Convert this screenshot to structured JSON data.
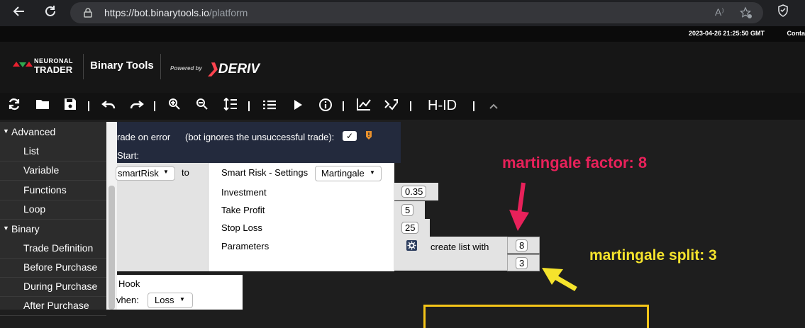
{
  "browser": {
    "url_host": "https://bot.binarytools.io",
    "url_path": "/platform",
    "read_aloud_label": "A⁾"
  },
  "topline": {
    "timestamp": "2023-04-26 21:25:50 GMT",
    "contact": "Conta"
  },
  "header": {
    "brand_top": "NEURONAL",
    "brand_bottom": "TRADER",
    "app_name": "Binary Tools",
    "powered_by": "Powered by",
    "deriv": "DERIV"
  },
  "toolbar": {
    "hid_label": "H-ID"
  },
  "sidebar": {
    "categories": [
      {
        "label": "Advanced",
        "items": [
          "List",
          "Variable",
          "Functions",
          "Loop"
        ]
      },
      {
        "label": "Binary",
        "items": [
          "Trade Definition",
          "Before Purchase",
          "During Purchase",
          "After Purchase"
        ]
      }
    ]
  },
  "workspace": {
    "trade_on_error": "rade on error",
    "bot_ignores": "(bot ignores the unsuccessful trade):",
    "checkbox_mark": "✓",
    "start_label": "Start:",
    "var_name": "smartRisk",
    "to_label": "to",
    "smart_risk_settings": "Smart Risk - Settings",
    "strategy": "Martingale",
    "params": [
      {
        "label": "Investment",
        "value": "0.35"
      },
      {
        "label": "Take Profit",
        "value": "5"
      },
      {
        "label": "Stop Loss",
        "value": "25"
      },
      {
        "label": "Parameters",
        "value": ""
      }
    ],
    "create_list_with": "create list with",
    "list_values": [
      "8",
      "3"
    ],
    "hook_label": "Hook",
    "when_label": "vhen:",
    "when_value": "Loss"
  },
  "annotations": {
    "martingale_factor": "martingale factor: 8",
    "martingale_split": "martingale split: 3"
  },
  "colors": {
    "annotation_red": "#e8215a",
    "annotation_yellow": "#f5e32c",
    "deriv_red": "#ff444f"
  },
  "icons": [
    "back-icon",
    "reload-icon",
    "lock-icon",
    "read-aloud-icon",
    "favorites-icon",
    "shield-icon",
    "refresh-icon",
    "folder-icon",
    "save-icon",
    "undo-icon",
    "redo-icon",
    "zoom-in-icon",
    "zoom-out-icon",
    "sort-icon",
    "list-icon",
    "play-icon",
    "info-icon",
    "chart-icon",
    "shuffle-icon",
    "chevron-up-icon"
  ]
}
